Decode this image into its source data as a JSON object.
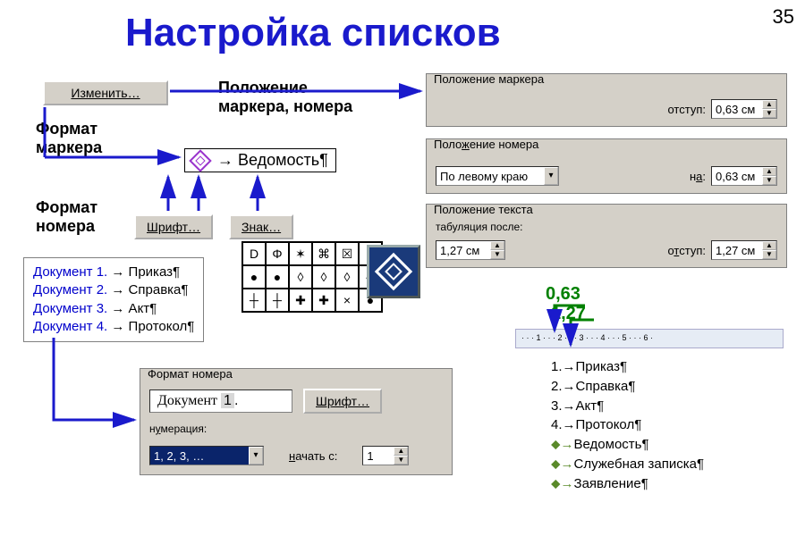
{
  "page_number": "35",
  "title": "Настройка списков",
  "buttons": {
    "edit": "Изменить…",
    "font": "Шрифт…",
    "char": "Знак…",
    "font2": "Шрифт…"
  },
  "labels": {
    "marker_format": "Формат\nмаркера",
    "number_format": "Формат\nномера",
    "pos_marker_number": "Положение\nмаркера, номера"
  },
  "bullet_sample_text": "→ Ведомость¶",
  "group_marker_position": {
    "legend": "Положение маркера",
    "indent_label": "отступ:",
    "indent_value": "0,63 см"
  },
  "group_number_position": {
    "legend": "Положение номера",
    "align": "По левому краю",
    "on_label": "на:",
    "on_value": "0,63 см"
  },
  "group_text_position": {
    "legend": "Положение текста",
    "tab_after_label": "табуляция после:",
    "tab_after_value": "1,27 см",
    "indent_label": "отступ:",
    "indent_value": "1,27 см"
  },
  "doc_list": [
    {
      "prefix": "Документ 1.",
      "text": "→ Приказ¶"
    },
    {
      "prefix": "Документ 2.",
      "text": "→ Справка¶"
    },
    {
      "prefix": "Документ 3.",
      "text": "→ Акт¶"
    },
    {
      "prefix": "Документ 4.",
      "text": "→ Протокол¶"
    }
  ],
  "number_format_group": {
    "legend": "Формат номера",
    "sample": "Документ 1.",
    "numbering_label": "нумерация:",
    "numbering_value": "1, 2, 3, …",
    "start_label": "начать с:",
    "start_value": "1"
  },
  "char_grid": [
    "D",
    "Φ",
    "✶",
    "⌘",
    "☒",
    "●",
    "●",
    "●",
    "◊",
    "◊",
    "◊",
    "⬥",
    "┼",
    "┼",
    "✚",
    "✚",
    "×",
    "●"
  ],
  "annotations": {
    "a063": "0,63",
    "a127": "1,27"
  },
  "right_list": [
    {
      "pre": "1.→",
      "text": "Приказ¶"
    },
    {
      "pre": "2.→",
      "text": "Справка¶"
    },
    {
      "pre": "3.→",
      "text": "Акт¶"
    },
    {
      "pre": "4.→",
      "text": "Протокол¶"
    },
    {
      "pre": "⬥→",
      "text": "Ведомость¶",
      "m": true
    },
    {
      "pre": "⬥→",
      "text": "Служебная записка¶",
      "m": true
    },
    {
      "pre": "⬥→",
      "text": "Заявление¶",
      "m": true
    }
  ],
  "ruler_text": "· · · 1 · · · 2 · · · 3 · · · 4 · · · 5 · · · 6 ·"
}
